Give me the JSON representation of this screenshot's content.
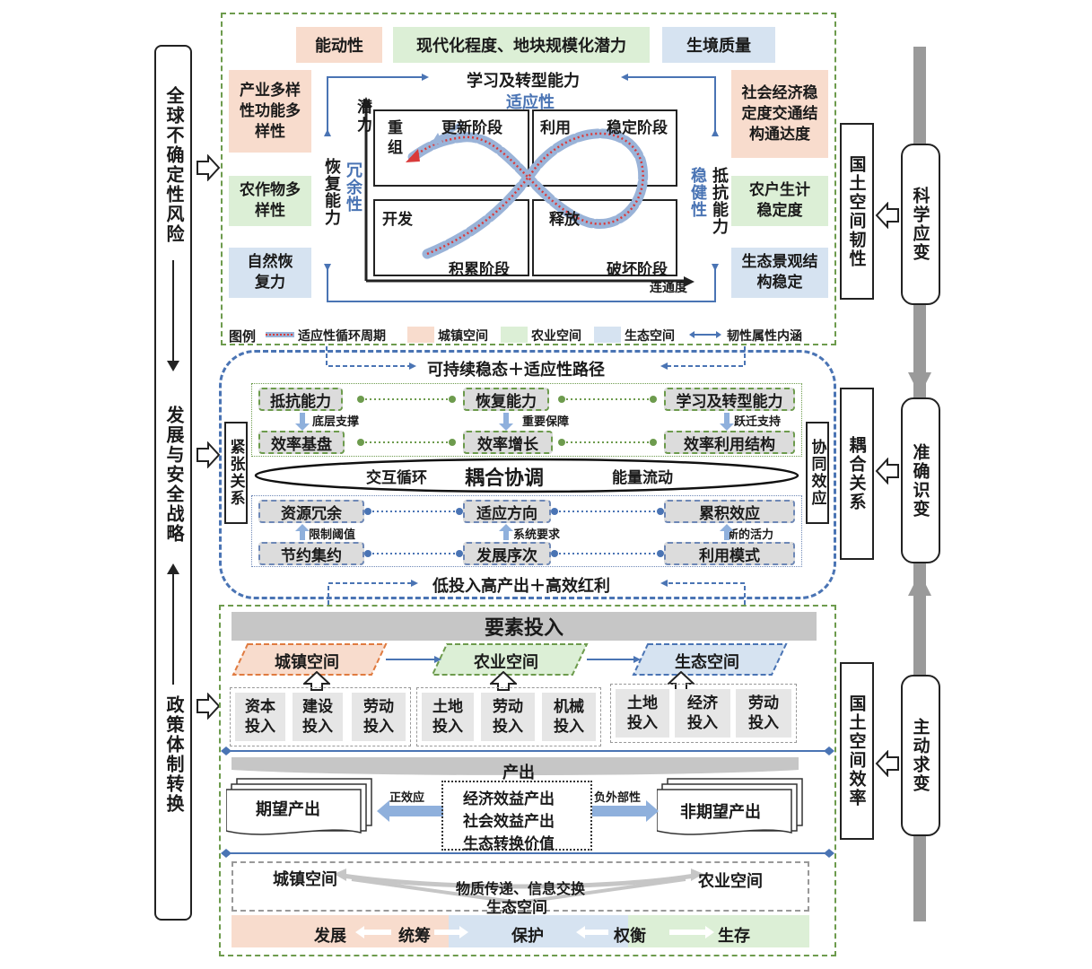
{
  "left_bar": {
    "top": "全球不确定性风险",
    "mid": "发展与安全战略",
    "bottom": "政策体制转换"
  },
  "right_bars": {
    "r1": "国土空间韧性",
    "r2": "耦合关系",
    "r3": "国土空间效率",
    "h1": "科学应变",
    "h2": "准确识变",
    "h3": "主动求变"
  },
  "top_panel": {
    "header1": "能动性",
    "header2": "现代化程度、地块规模化潜力",
    "header3": "生境质量",
    "learn": "学习及转型能力",
    "adapt": "适应性",
    "left1": "产业多样性功能多样性",
    "left2": "农作物多样性",
    "left3": "自然恢复力",
    "right1": "社会经济稳定度交通结构通达度",
    "right2": "农户生计稳定度",
    "right3": "生态景观结构稳定",
    "recover": "恢复能力",
    "redundant": "冗余性",
    "robust": "稳健性",
    "resist": "抵抗能力",
    "potential": "潜力",
    "connect": "连通度",
    "q_reorg": "重组",
    "q_renew": "更新阶段",
    "q_use": "利用",
    "q_stable": "稳定阶段",
    "q_dev": "开发",
    "q_accum": "积累阶段",
    "q_release": "释放",
    "q_destroy": "破坏阶段"
  },
  "legend": {
    "title": "图例",
    "cycle": "适应性循环周期",
    "town": "城镇空间",
    "farm": "农业空间",
    "eco": "生态空间",
    "attr": "韧性属性内涵"
  },
  "middle_panel": {
    "top_path": "可持续稳态＋适应性路径",
    "bottom_path": "低投入高产出＋高效红利",
    "tension": "紧张关系",
    "synergy": "协同效应",
    "r1": [
      "抵抗能力",
      "恢复能力",
      "学习及转型能力"
    ],
    "r1_links": [
      "底层支撑",
      "重要保障",
      "跃迁支持"
    ],
    "r2": [
      "效率基盘",
      "效率增长",
      "效率利用结构"
    ],
    "ellipse_left": "交互循环",
    "ellipse_mid": "耦合协调",
    "ellipse_right": "能量流动",
    "r3": [
      "资源冗余",
      "适应方向",
      "累积效应"
    ],
    "r3_links": [
      "限制阈值",
      "系统要求",
      "新的活力"
    ],
    "r4": [
      "节约集约",
      "发展序次",
      "利用模式"
    ]
  },
  "bottom_panel": {
    "inputs_header": "要素投入",
    "spaces": [
      "城镇空间",
      "农业空间",
      "生态空间"
    ],
    "inputs": [
      "资本投入",
      "建设投入",
      "劳动投入",
      "土地投入",
      "劳动投入",
      "机械投入",
      "土地投入",
      "经济投入",
      "劳动投入"
    ],
    "output_header": "产出",
    "desired": "期望产出",
    "undesired": "非期望产出",
    "positive": "正效应",
    "negative": "负外部性",
    "benefits": [
      "经济效益产出",
      "社会效益产出",
      "生态转换价值"
    ],
    "flow_left": "城镇空间",
    "flow_right": "农业空间",
    "flow_mid": "物质传递、信息交换",
    "flow_bottom": "生态空间",
    "band": [
      "发展",
      "统筹",
      "保护",
      "权衡",
      "生存"
    ]
  },
  "colors": {
    "town": "#f8dccd",
    "farm": "#dcefd6",
    "eco": "#d6e3f1",
    "green_dash": "#6d9b4d",
    "blue_dash": "#4a74b4",
    "cycle_red": "#d93a3a",
    "cycle_blue": "#9ab3d8"
  }
}
